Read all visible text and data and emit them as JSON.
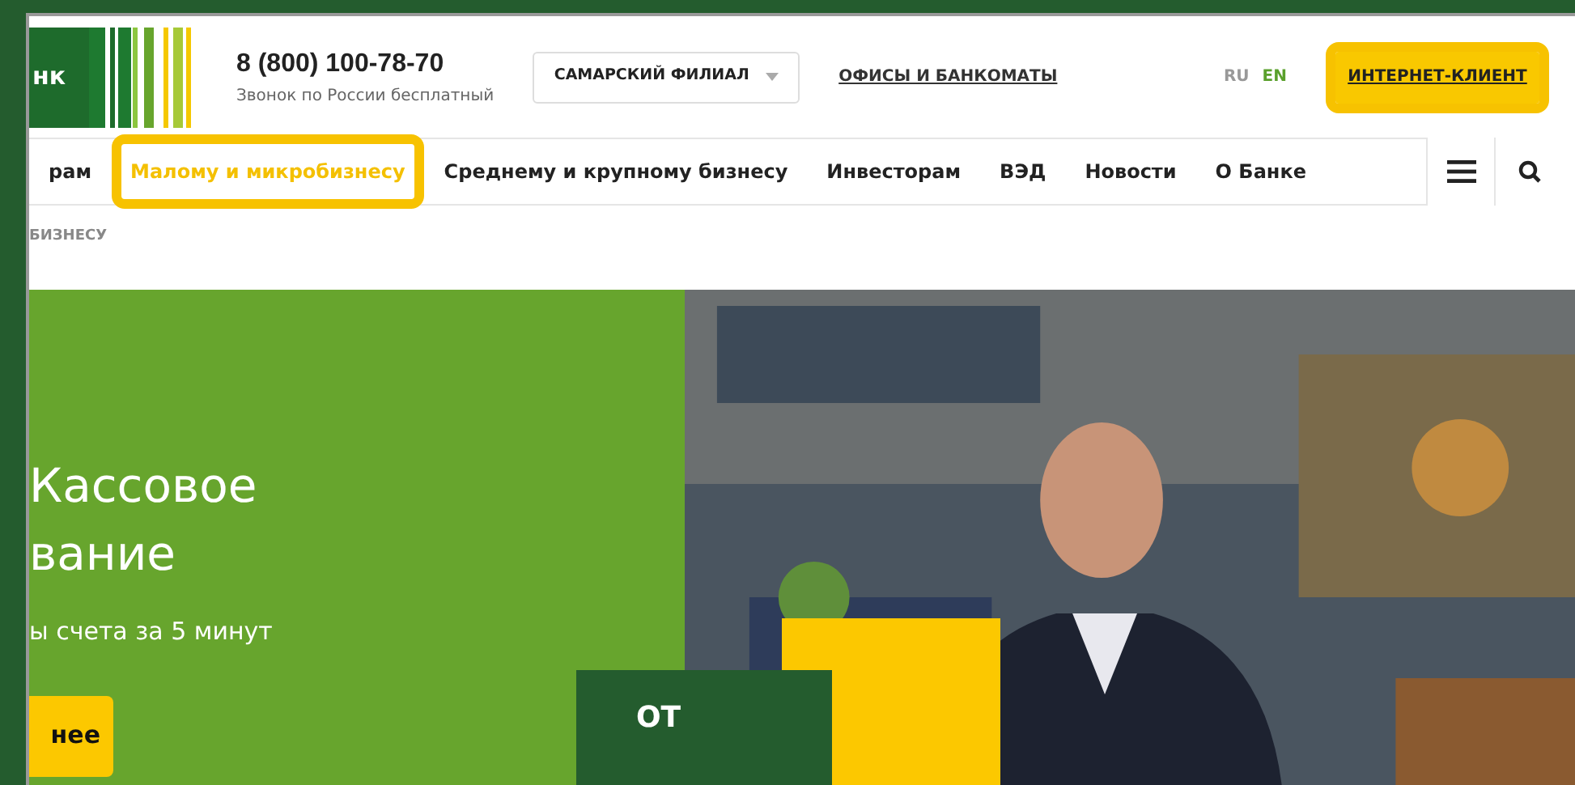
{
  "logo": {
    "text": "нк"
  },
  "phone": {
    "number": "8 (800) 100-78-70",
    "note": "Звонок по России бесплатный"
  },
  "branch_select": {
    "value": "САМАРСКИЙ ФИЛИАЛ"
  },
  "offices_link": "ОФИСЫ И БАНКОМАТЫ",
  "languages": [
    {
      "label": "RU",
      "selected": false
    },
    {
      "label": "EN",
      "selected": true
    }
  ],
  "login_button": {
    "label": "ИНТЕРНЕТ-КЛИЕНТ",
    "highlighted": true
  },
  "nav": [
    {
      "label": "рам",
      "selected": false,
      "highlighted": false
    },
    {
      "label": "Малому и микробизнесу",
      "selected": true,
      "highlighted": true
    },
    {
      "label": "Среднему и крупному бизнесу",
      "selected": false,
      "highlighted": false
    },
    {
      "label": "Инвесторам",
      "selected": false,
      "highlighted": false
    },
    {
      "label": "ВЭД",
      "selected": false,
      "highlighted": false
    },
    {
      "label": "Новости",
      "selected": false,
      "highlighted": false
    },
    {
      "label": "О Банке",
      "selected": false,
      "highlighted": false
    }
  ],
  "breadcrumb": "БИЗНЕСУ",
  "hero": {
    "title_lines": [
      "Кассовое",
      "вание"
    ],
    "subtitle": "ы счета за 5 минут",
    "button": "нее",
    "price_prefix": "ОТ"
  }
}
